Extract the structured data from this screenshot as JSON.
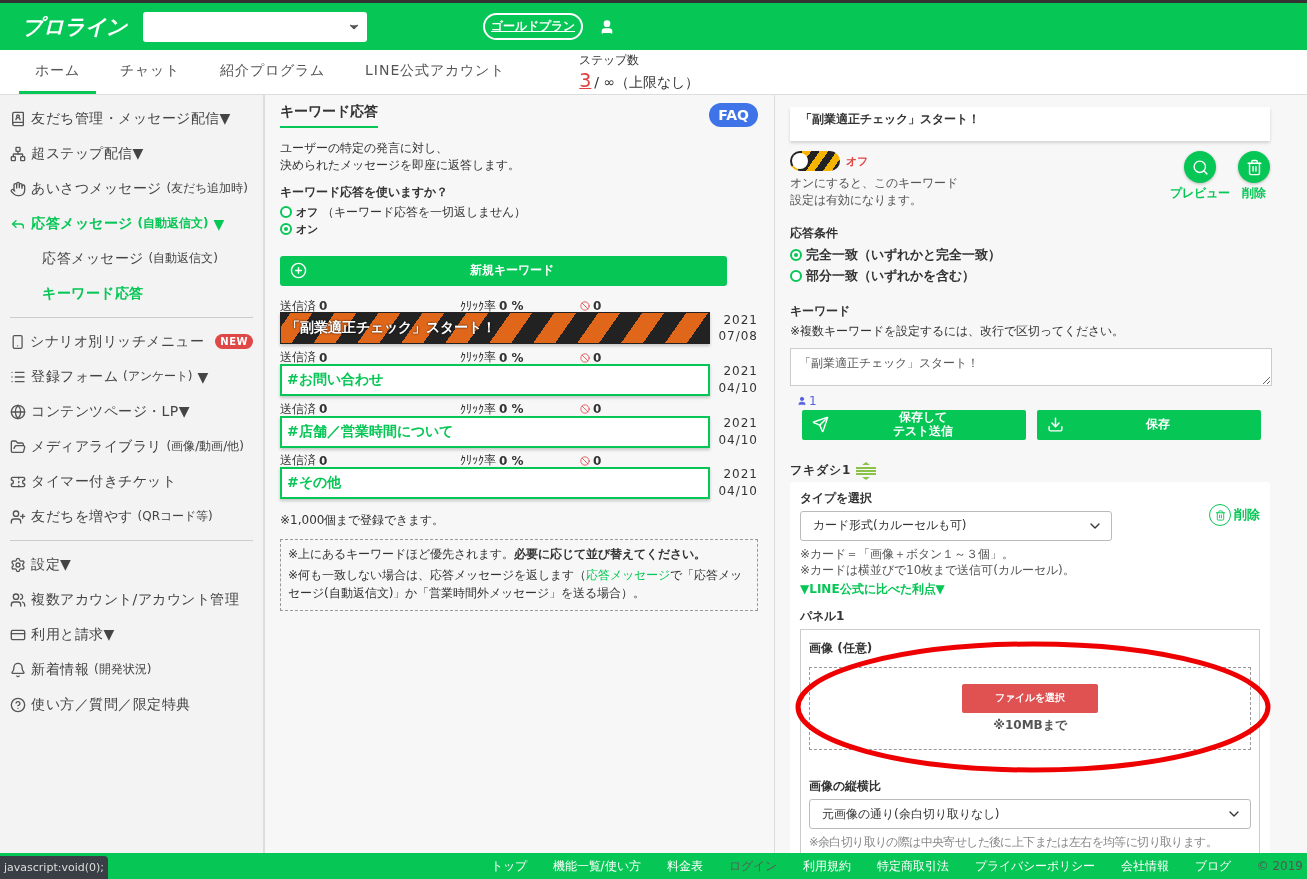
{
  "header": {
    "logo": "プロライン",
    "plan_badge": "ゴールドプラン"
  },
  "nav": {
    "tabs": [
      {
        "label": "ホーム",
        "selected": true
      },
      {
        "label": "チャット",
        "selected": false
      },
      {
        "label": "紹介プログラム",
        "selected": false
      },
      {
        "label": "LINE公式アカウント",
        "selected": false
      }
    ],
    "steps": {
      "label": "ステップ数",
      "count": "3",
      "limit": "/ ∞（上限なし）"
    }
  },
  "sidebar": {
    "sections": [
      [
        {
          "label": "友だち管理・メッセージ配信",
          "caret": "▼",
          "selected": false
        },
        {
          "label": "超ステップ配信",
          "caret": "▼",
          "selected": false
        },
        {
          "label": "あいさつメッセージ",
          "note": "(友だち追加時)",
          "selected": false
        },
        {
          "label": "応答メッセージ",
          "note": "(自動返信文)",
          "caret": "▼",
          "selected": true,
          "children": [
            {
              "label": "応答メッセージ",
              "note": "(自動返信文)",
              "selected": false
            },
            {
              "label": "キーワード応答",
              "selected": true
            }
          ]
        }
      ],
      [
        {
          "label": "シナリオ別リッチメニュー",
          "badge": "NEW",
          "selected": false
        },
        {
          "label": "登録フォーム",
          "note": "(アンケート)",
          "caret": "▼",
          "selected": false
        },
        {
          "label": "コンテンツページ・LP",
          "caret": "▼",
          "selected": false
        },
        {
          "label": "メディアライブラリ",
          "note": "(画像/動画/他)",
          "selected": false
        },
        {
          "label": "タイマー付きチケット",
          "selected": false
        },
        {
          "label": "友だちを増やす",
          "note": "(QRコード等)",
          "selected": false
        }
      ],
      [
        {
          "label": "設定",
          "caret": "▼",
          "selected": false
        },
        {
          "label": "複数アカウント/アカウント管理",
          "selected": false
        },
        {
          "label": "利用と請求",
          "caret": "▼",
          "selected": false
        },
        {
          "label": "新着情報",
          "note": "(開発状況)",
          "selected": false
        },
        {
          "label": "使い方／質問／限定特典",
          "selected": false
        }
      ]
    ]
  },
  "main": {
    "title": "キーワード応答",
    "faq": "FAQ",
    "description": [
      "ユーザーの特定の発言に対し、",
      "決められたメッセージを即座に返答します。"
    ],
    "question": "キーワード応答を使いますか？",
    "options": [
      {
        "label": "オフ",
        "note": "（キーワード応答を一切返しません）",
        "selected": false
      },
      {
        "label": "オン",
        "selected": true
      }
    ],
    "new_button": "新規キーワード",
    "keywords": [
      {
        "kind": "striped",
        "title": "「副業適正チェック」スタート！",
        "sent_label": "送信済",
        "sent": "0",
        "click_label": "ｸﾘｯｸ率",
        "click": "0 %",
        "blocked": "0",
        "year": "2021",
        "date": "07/08"
      },
      {
        "kind": "plain",
        "title": "#お問い合わせ",
        "sent_label": "送信済",
        "sent": "0",
        "click_label": "ｸﾘｯｸ率",
        "click": "0 %",
        "blocked": "0",
        "year": "2021",
        "date": "04/10"
      },
      {
        "kind": "plain",
        "title": "#店舗／営業時間について",
        "sent_label": "送信済",
        "sent": "0",
        "click_label": "ｸﾘｯｸ率",
        "click": "0 %",
        "blocked": "0",
        "year": "2021",
        "date": "04/10"
      },
      {
        "kind": "plain",
        "title": "#その他",
        "sent_label": "送信済",
        "sent": "0",
        "click_label": "ｸﾘｯｸ率",
        "click": "0 %",
        "blocked": "0",
        "year": "2021",
        "date": "04/10"
      }
    ],
    "limit_note": "※1,000個まで登録できます。",
    "notes": [
      {
        "text": "※上にあるキーワードほど優先されます。**必要に応じて並び替えてください。**"
      },
      {
        "before": "※何も一致しない場合は、応答メッセージを返します（",
        "link": "応答メッセージ",
        "after": "で「応答メッセージ(自動返信文)」か「営業時間外メッセージ」を送る場合）。"
      }
    ]
  },
  "editor": {
    "preview_text": "「副業適正チェック」スタート！",
    "toggle": {
      "on": false,
      "label": "オフ"
    },
    "toggle_note": [
      "オンにすると、このキーワード",
      "設定は有効になります。"
    ],
    "actions": [
      {
        "label": "プレビュー"
      },
      {
        "label": "削除"
      }
    ],
    "condition_title": "応答条件",
    "conditions": [
      {
        "label": "完全一致（いずれかと完全一致）",
        "selected": true
      },
      {
        "label": "部分一致（いずれかを含む）",
        "selected": false
      }
    ],
    "keyword_title": "キーワード",
    "keyword_hint": "※複数キーワードを設定するには、改行で区切ってください。",
    "keyword_value": "「副業適正チェック」スタート！",
    "user_count": "1",
    "buttons": [
      {
        "label": [
          "保存して",
          "テスト送信"
        ]
      },
      {
        "label": [
          "保存"
        ]
      }
    ],
    "bubble": {
      "title": "フキダシ1",
      "type_label": "タイプを選択",
      "delete": "削除",
      "type_value": "カード形式(カルーセルも可)",
      "type_notes": [
        "※カード＝「画像＋ボタン１～３個」。",
        "※カードは横並びで10枚まで送信可(カルーセル)。"
      ],
      "benefit_link": "▼LINE公式に比べた利点▼",
      "panel": {
        "title": "パネル1",
        "image_label": "画像",
        "image_note": "(任意)",
        "file_button": "ファイルを選択",
        "size_note": "※10MBまで",
        "aspect_label": "画像の縦横比",
        "aspect_value": "元画像の通り(余白切り取りなし)",
        "crop_note": "※余白切り取りの際は中央寄せした後に上下または左右を均等に切り取ります。"
      }
    }
  },
  "footer": {
    "links": [
      {
        "label": "トップ",
        "muted": false
      },
      {
        "label": "機能一覧/使い方",
        "muted": false
      },
      {
        "label": "料金表",
        "muted": false
      },
      {
        "label": "ログイン",
        "muted": true
      },
      {
        "label": "利用規約",
        "muted": false
      },
      {
        "label": "特定商取引法",
        "muted": false
      },
      {
        "label": "プライバシーポリシー",
        "muted": false
      },
      {
        "label": "会社情報",
        "muted": false
      },
      {
        "label": "ブログ",
        "muted": false
      }
    ],
    "copyright": "© 2019"
  },
  "status_bar": "javascript:void(0);"
}
